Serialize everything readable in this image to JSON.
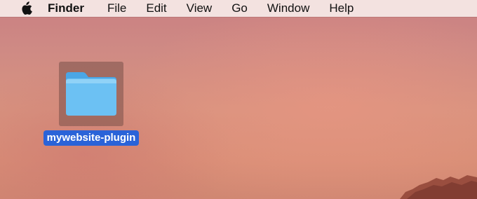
{
  "menubar": {
    "apple_icon": "apple-logo-icon",
    "app_name": "Finder",
    "items": [
      "File",
      "Edit",
      "View",
      "Go",
      "Window",
      "Help"
    ]
  },
  "desktop": {
    "folder": {
      "icon": "folder-icon",
      "name": "mywebsite-plugin",
      "selected": true
    }
  },
  "colors": {
    "selection_label": "#2a63d8",
    "folder_blue": "#6cc1f3",
    "menubar_bg": "#f5e6e4"
  }
}
